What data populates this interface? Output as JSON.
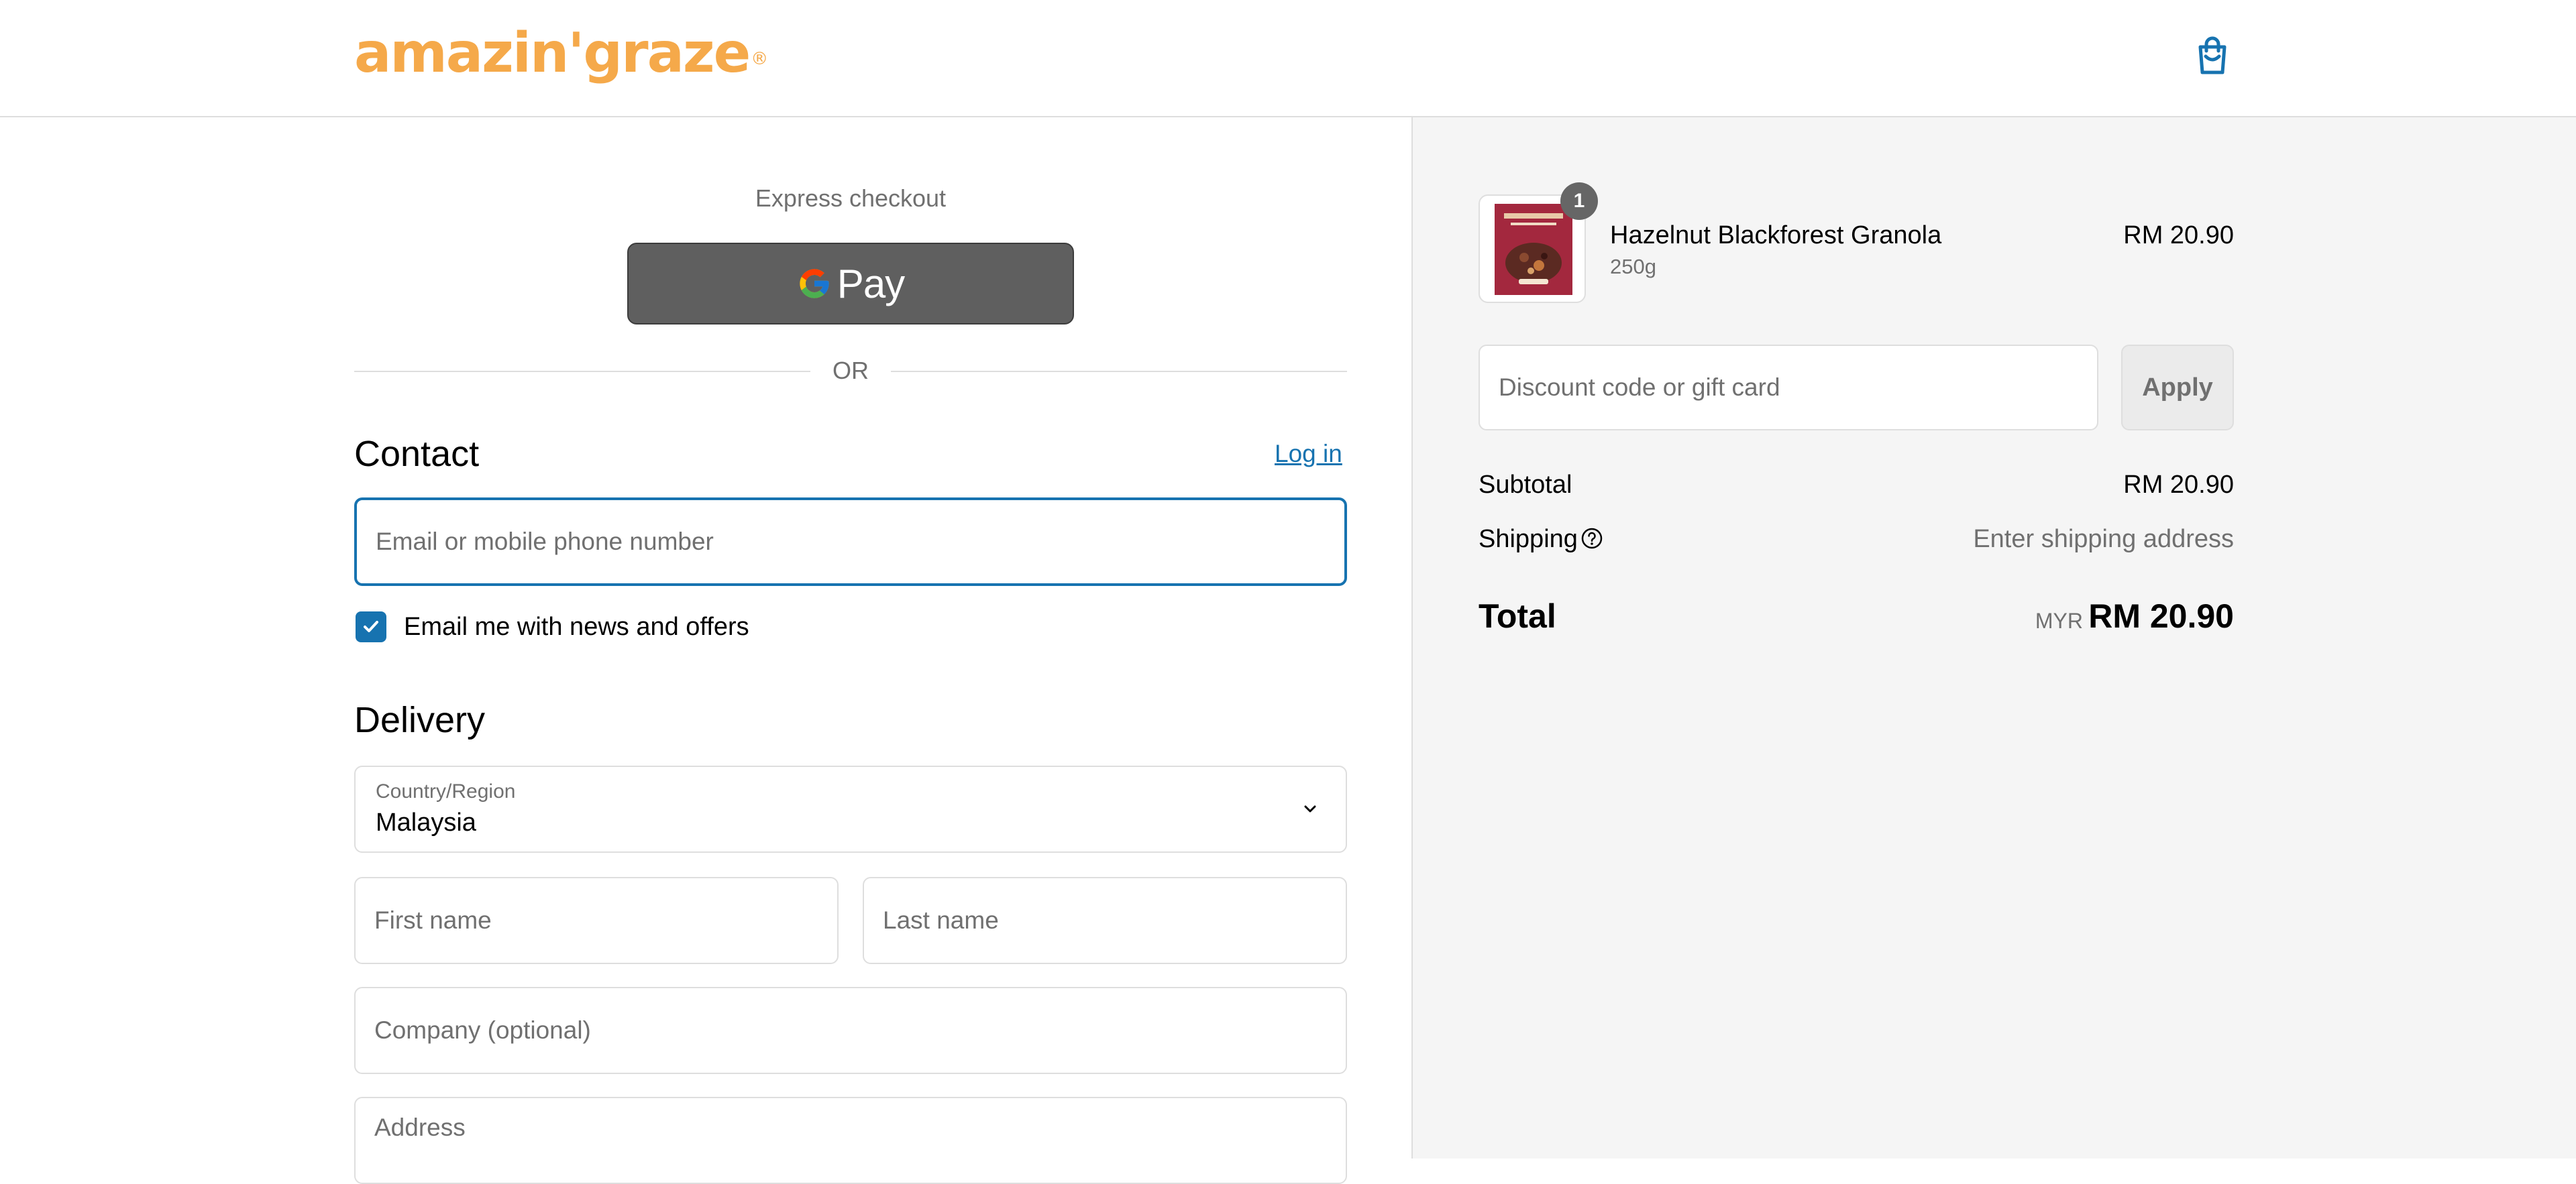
{
  "brand": {
    "logo_text": "amazin'graze",
    "registered_mark": "®",
    "logo_color": "#f5a94a",
    "accent_color": "#1773b0"
  },
  "header": {
    "cart_icon": "shopping-bag-icon"
  },
  "express": {
    "title": "Express checkout",
    "gpay_label": "Pay",
    "gpay_icon": "google-g-icon",
    "or_divider": "OR"
  },
  "contact": {
    "title": "Contact",
    "login_link": "Log in",
    "email_placeholder": "Email or mobile phone number",
    "newsletter_label": "Email me with news and offers",
    "newsletter_checked": true
  },
  "delivery": {
    "title": "Delivery",
    "country_label": "Country/Region",
    "country_value": "Malaysia",
    "first_name_placeholder": "First name",
    "last_name_placeholder": "Last name",
    "company_placeholder": "Company (optional)",
    "address_placeholder": "Address"
  },
  "summary": {
    "item": {
      "name": "Hazelnut Blackforest Granola",
      "variant": "250g",
      "price": "RM 20.90",
      "quantity": "1"
    },
    "discount_placeholder": "Discount code or gift card",
    "apply_label": "Apply",
    "subtotal_label": "Subtotal",
    "subtotal_value": "RM 20.90",
    "shipping_label": "Shipping",
    "shipping_value": "Enter shipping address",
    "total_label": "Total",
    "total_currency": "MYR",
    "total_value": "RM 20.90"
  }
}
